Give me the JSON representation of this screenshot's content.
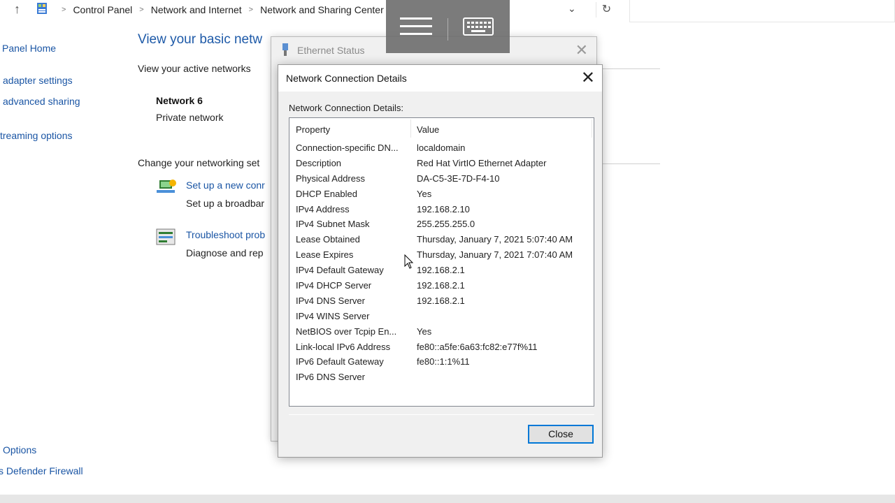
{
  "address_bar": {
    "breadcrumbs": [
      "Control Panel",
      "Network and Internet",
      "Network and Sharing Center"
    ]
  },
  "left_nav": {
    "items": [
      "Panel Home",
      "adapter settings",
      "advanced sharing",
      "treaming options"
    ],
    "see_also": [
      "Options",
      "s Defender Firewall"
    ]
  },
  "main": {
    "title": "View your basic netw",
    "active_networks_label": "View your active networks",
    "network_name": "Network 6",
    "network_type": "Private network",
    "change_settings_label": "Change your networking set",
    "tasks": [
      {
        "link": "Set up a new conr",
        "desc": "Set up a broadbar"
      },
      {
        "link": "Troubleshoot prob",
        "desc": "Diagnose and rep"
      }
    ]
  },
  "ethernet_status": {
    "title": "Ethernet Status"
  },
  "details_dialog": {
    "title": "Network Connection Details",
    "label": "Network Connection Details:",
    "columns": [
      "Property",
      "Value"
    ],
    "rows": [
      {
        "property": "Connection-specific DN...",
        "value": "localdomain"
      },
      {
        "property": "Description",
        "value": "Red Hat VirtIO Ethernet Adapter"
      },
      {
        "property": "Physical Address",
        "value": "DA-C5-3E-7D-F4-10"
      },
      {
        "property": "DHCP Enabled",
        "value": "Yes"
      },
      {
        "property": "IPv4 Address",
        "value": "192.168.2.10"
      },
      {
        "property": "IPv4 Subnet Mask",
        "value": "255.255.255.0"
      },
      {
        "property": "Lease Obtained",
        "value": "Thursday, January 7, 2021 5:07:40 AM"
      },
      {
        "property": "Lease Expires",
        "value": "Thursday, January 7, 2021 7:07:40 AM"
      },
      {
        "property": "IPv4 Default Gateway",
        "value": "192.168.2.1"
      },
      {
        "property": "IPv4 DHCP Server",
        "value": "192.168.2.1"
      },
      {
        "property": "IPv4 DNS Server",
        "value": "192.168.2.1"
      },
      {
        "property": "IPv4 WINS Server",
        "value": ""
      },
      {
        "property": "NetBIOS over Tcpip En...",
        "value": "Yes"
      },
      {
        "property": "Link-local IPv6 Address",
        "value": "fe80::a5fe:6a63:fc82:e77f%11"
      },
      {
        "property": "IPv6 Default Gateway",
        "value": "fe80::1:1%11"
      },
      {
        "property": "IPv6 DNS Server",
        "value": ""
      }
    ],
    "close_label": "Close"
  },
  "icons": {
    "up": "up-arrow-icon",
    "control_panel": "control-panel-icon",
    "chevron": "chevron-down-icon",
    "refresh": "refresh-icon",
    "menu": "hamburger-menu-icon",
    "keyboard": "keyboard-icon",
    "close": "close-icon"
  }
}
